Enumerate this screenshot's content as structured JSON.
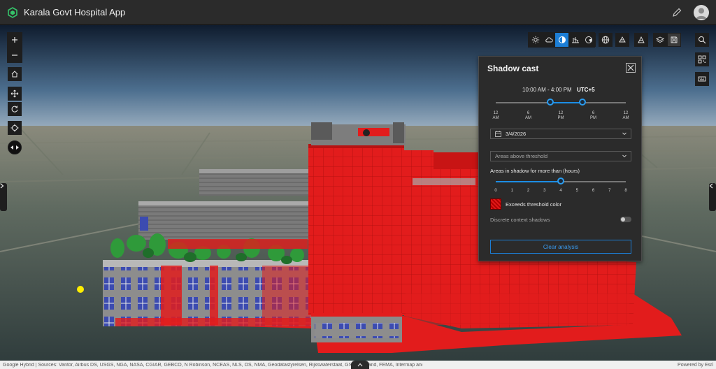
{
  "header": {
    "title": "Karala Govt Hospital App",
    "icons": {
      "logo": "app-cube-logo",
      "edit": "pencil-icon",
      "user": "user-avatar-icon"
    }
  },
  "map": {
    "navigation_tools": [
      "zoom-in",
      "zoom-out",
      "home",
      "pan",
      "rotate",
      "compass",
      "toggle-navigation"
    ],
    "top_toolbar": [
      "daylight",
      "weather",
      "shadow-cast",
      "line-of-sight",
      "viewshed",
      "basemap-gallery",
      "slice",
      "measure",
      "layer-list",
      "save"
    ],
    "right_toolbar": [
      "search",
      "qr-code",
      "keyboard"
    ],
    "colors": {
      "shadow": "#e21c1c",
      "accent": "#1c7ed6"
    }
  },
  "shadow_panel": {
    "title": "Shadow cast",
    "time_range": "10:00 AM - 4:00 PM",
    "timezone": "UTC+5",
    "time_start_hour": 10,
    "time_end_hour": 16,
    "time_ticks": [
      {
        "top": "12",
        "bottom": "AM"
      },
      {
        "top": "6",
        "bottom": "AM"
      },
      {
        "top": "12",
        "bottom": "PM"
      },
      {
        "top": "6",
        "bottom": "PM"
      },
      {
        "top": "12",
        "bottom": "AM"
      }
    ],
    "date": "3/4/2026",
    "visualization": "Areas above threshold",
    "threshold_label": "Areas in shadow for more than (hours)",
    "threshold_value": 4,
    "threshold_ticks": [
      "0",
      "1",
      "2",
      "3",
      "4",
      "5",
      "6",
      "7",
      "8"
    ],
    "color_label": "Exceeds threshold color",
    "discrete_label": "Discrete context shadows",
    "discrete_enabled": false,
    "clear_button": "Clear analysis"
  },
  "footer": {
    "attribution": "Google Hybrid | Sources: Vantor, Airbus DS, USGS, NGA, NASA, CGIAR, GEBCO, N Robinson, NCEAS, NLS, OS, NMA, Geodatastyrelsen, Rijkswaterstaat, GSA, Geoland, FEMA, Intermap and the GIS User Community",
    "powered_by": "Powered by Esri"
  }
}
